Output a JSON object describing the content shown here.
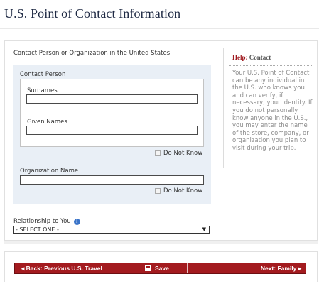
{
  "page": {
    "title": "U.S. Point of Contact Information"
  },
  "form": {
    "section_label": "Contact Person or Organization in the United States",
    "contact_person": {
      "label": "Contact Person",
      "surnames_label": "Surnames",
      "surnames_value": "",
      "given_names_label": "Given Names",
      "given_names_value": "",
      "do_not_know_label": "Do Not Know"
    },
    "organization": {
      "label": "Organization Name",
      "value": "",
      "do_not_know_label": "Do Not Know"
    },
    "relationship": {
      "label": "Relationship to You",
      "info_icon": "i",
      "selected": "- SELECT ONE -",
      "arrow": "▼"
    }
  },
  "help": {
    "title_prefix": "Help:",
    "title_topic": "Contact",
    "text": "Your U.S. Point of Contact can be any individual in the U.S. who knows you and can verify, if necessary, your identity. If you do not personally know anyone in the U.S., you may enter the name of the store, company, or organization you plan to visit during your trip."
  },
  "nav": {
    "back_label": "◂ Back: Previous U.S. Travel",
    "save_label": "Save",
    "next_label": "Next: Family ▸"
  }
}
